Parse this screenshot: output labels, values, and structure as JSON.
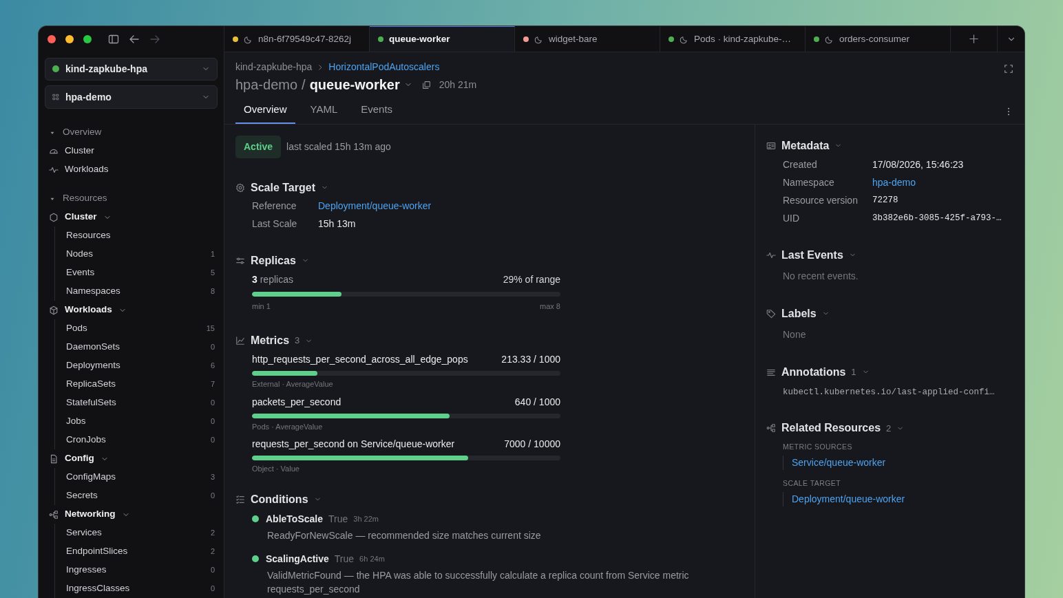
{
  "window": {
    "tabs": [
      {
        "label": "n8n-6f79549c47-8262j",
        "color": "#e5c03a",
        "selected": false
      },
      {
        "label": "queue-worker",
        "color": "#4caf50",
        "selected": true
      },
      {
        "label": "widget-bare",
        "color": "#f29a96",
        "selected": false
      },
      {
        "label": "Pods · kind-zapkube-…",
        "color": "#4caf50",
        "selected": false
      },
      {
        "label": "orders-consumer",
        "color": "#4caf50",
        "selected": false
      }
    ]
  },
  "sidebar": {
    "context": {
      "label": "kind-zapkube-hpa",
      "connected": true
    },
    "namespace": {
      "label": "hpa-demo"
    },
    "overview": {
      "title": "Overview",
      "expanded": true,
      "items": [
        {
          "label": "Cluster"
        },
        {
          "label": "Workloads"
        }
      ]
    },
    "resources": {
      "title": "Resources",
      "expanded": true,
      "groups": [
        {
          "label": "Cluster",
          "expanded": true,
          "children": [
            {
              "label": "Resources"
            },
            {
              "label": "Nodes",
              "count": "1"
            },
            {
              "label": "Events",
              "count": "5"
            },
            {
              "label": "Namespaces",
              "count": "8"
            }
          ]
        },
        {
          "label": "Workloads",
          "expanded": true,
          "children": [
            {
              "label": "Pods",
              "count": "15"
            },
            {
              "label": "DaemonSets",
              "count": "0"
            },
            {
              "label": "Deployments",
              "count": "6"
            },
            {
              "label": "ReplicaSets",
              "count": "7"
            },
            {
              "label": "StatefulSets",
              "count": "0"
            },
            {
              "label": "Jobs",
              "count": "0"
            },
            {
              "label": "CronJobs",
              "count": "0"
            }
          ]
        },
        {
          "label": "Config",
          "expanded": true,
          "children": [
            {
              "label": "ConfigMaps",
              "count": "3"
            },
            {
              "label": "Secrets",
              "count": "0"
            }
          ]
        },
        {
          "label": "Networking",
          "expanded": true,
          "children": [
            {
              "label": "Services",
              "count": "2"
            },
            {
              "label": "EndpointSlices",
              "count": "2"
            },
            {
              "label": "Ingresses",
              "count": "0"
            },
            {
              "label": "IngressClasses",
              "count": "0"
            }
          ]
        }
      ]
    }
  },
  "header": {
    "breadcrumb": [
      "kind-zapkube-hpa",
      "HorizontalPodAutoscalers"
    ],
    "namespace": "hpa-demo",
    "separator": "/",
    "name": "queue-worker",
    "age": "20h 21m",
    "tabs": [
      {
        "label": "Overview",
        "selected": true
      },
      {
        "label": "YAML",
        "selected": false
      },
      {
        "label": "Events",
        "selected": false
      }
    ]
  },
  "status": {
    "badge": "Active",
    "text": "last scaled 15h 13m ago"
  },
  "scale_target": {
    "title": "Scale Target",
    "expanded": true,
    "rows": [
      {
        "label": "Reference",
        "value": "Deployment/queue-worker",
        "kind": "link"
      },
      {
        "label": "Last Scale",
        "value": "15h 13m",
        "kind": "text"
      }
    ]
  },
  "replicas": {
    "title": "Replicas",
    "expanded": true,
    "summary": "**3** replicas",
    "range": "29% of range",
    "level": 0.29,
    "min": "min 1",
    "max": "max 8"
  },
  "metrics": {
    "title": "Metrics",
    "count": "3",
    "expanded": true,
    "items": [
      {
        "name": "http_requests_per_second_across_all_edge_pops",
        "value": "213.33 / 1000",
        "level": 0.213,
        "type": "External · AverageValue"
      },
      {
        "name": "packets_per_second",
        "value": "640 / 1000",
        "level": 0.64,
        "type": "Pods · AverageValue"
      },
      {
        "name": "requests_per_second on Service/queue-worker",
        "value": "7000 / 10000",
        "level": 0.7,
        "type": "Object · Value"
      }
    ]
  },
  "conditions": {
    "title": "Conditions",
    "expanded": true,
    "items": [
      {
        "name": "AbleToScale",
        "status": "True",
        "age": "3h 22m",
        "message": "ReadyForNewScale — recommended size matches current size",
        "color": "#5fcf8c"
      },
      {
        "name": "ScalingActive",
        "status": "True",
        "age": "6h 24m",
        "message": "ValidMetricFound — the HPA was able to successfully calculate a replica count from Service metric requests_per_second",
        "color": "#5fcf8c"
      }
    ]
  },
  "metadata": {
    "title": "Metadata",
    "expanded": true,
    "rows": [
      {
        "label": "Created",
        "value": "17/08/2026, 15:46:23",
        "kind": "text"
      },
      {
        "label": "Namespace",
        "value": "hpa-demo",
        "kind": "link"
      },
      {
        "label": "Resource version",
        "value": "72278",
        "kind": "mono"
      },
      {
        "label": "UID",
        "value": "3b382e6b-3085-425f-a793-…",
        "kind": "mono"
      }
    ]
  },
  "last_events": {
    "title": "Last Events",
    "expanded": true,
    "empty": "No recent events."
  },
  "labels": {
    "title": "Labels",
    "expanded": true,
    "empty": "None"
  },
  "annotations": {
    "title": "Annotations",
    "count": "1",
    "expanded": true,
    "items": [
      "kubectl.kubernetes.io/last-applied-confi…"
    ]
  },
  "related": {
    "title": "Related Resources",
    "count": "2",
    "expanded": true,
    "groups": [
      {
        "heading": "METRIC SOURCES",
        "link": "Service/queue-worker"
      },
      {
        "heading": "SCALE TARGET",
        "link": "Deployment/queue-worker"
      }
    ]
  }
}
